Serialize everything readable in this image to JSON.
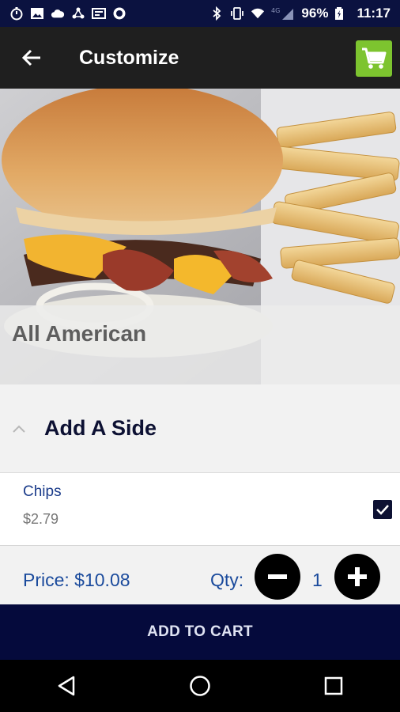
{
  "status_bar": {
    "left_icons": [
      "timer-icon",
      "image-icon",
      "cloud-icon",
      "share-icon",
      "cast-icon",
      "record-icon"
    ],
    "right_icons": [
      "bluetooth-icon",
      "vibrate-icon",
      "wifi-icon",
      "signal-4g-icon",
      "battery-icon"
    ],
    "battery": "96%",
    "time": "11:17"
  },
  "app_bar": {
    "title": "Customize",
    "back_icon": "arrow-left-icon",
    "cart_icon": "shopping-cart-icon",
    "cart_color": "#7dc42f"
  },
  "hero": {
    "item_name": "All American"
  },
  "section": {
    "title": "Add A Side",
    "chevron_icon": "chevron-up-icon"
  },
  "options": [
    {
      "name": "Chips",
      "price": "$2.79",
      "checked": true
    }
  ],
  "order": {
    "price_label": "Price: $10.08",
    "qty_label": "Qty:",
    "qty_value": "1"
  },
  "add_to_cart": "ADD TO CART",
  "nav": {
    "back_icon": "triangle-back-icon",
    "home_icon": "circle-home-icon",
    "recents_icon": "square-recents-icon"
  },
  "colors": {
    "status_bar": "#0b1240",
    "app_bar": "#1f1f1f",
    "primary_dark": "#050a3c",
    "price_blue": "#1a4a9c"
  }
}
